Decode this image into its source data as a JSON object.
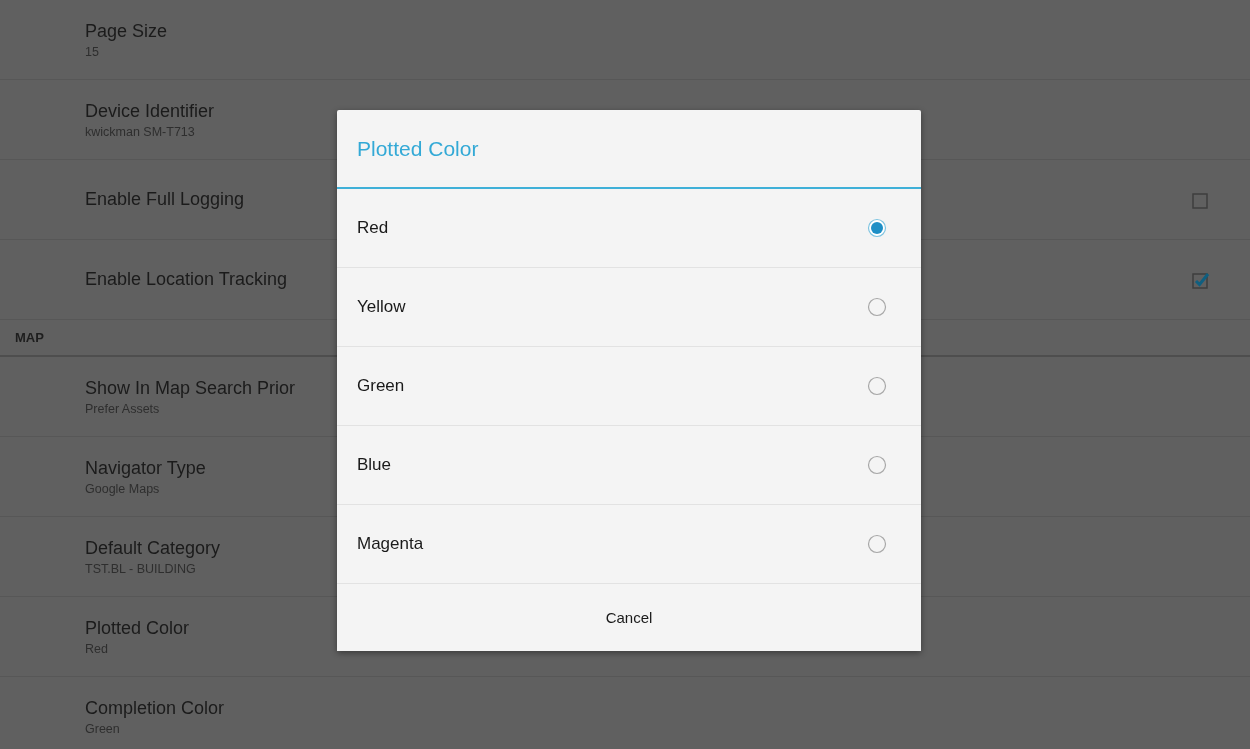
{
  "settings": [
    {
      "kind": "pref",
      "title": "Page Size",
      "summary": "15"
    },
    {
      "kind": "pref",
      "title": "Device Identifier",
      "summary": "kwickman SM-T713"
    },
    {
      "kind": "checkbox",
      "title": "Enable Full Logging",
      "checked": false
    },
    {
      "kind": "checkbox",
      "title": "Enable Location Tracking",
      "checked": true
    },
    {
      "kind": "category",
      "title": "MAP"
    },
    {
      "kind": "pref",
      "title": "Show In Map Search Prior",
      "summary": "Prefer Assets"
    },
    {
      "kind": "pref",
      "title": "Navigator Type",
      "summary": "Google Maps"
    },
    {
      "kind": "pref",
      "title": "Default Category",
      "summary": "TST.BL - BUILDING"
    },
    {
      "kind": "pref",
      "title": "Plotted Color",
      "summary": "Red"
    },
    {
      "kind": "pref",
      "title": "Completion Color",
      "summary": "Green"
    }
  ],
  "dialog": {
    "title": "Plotted Color",
    "options": [
      {
        "label": "Red",
        "selected": true
      },
      {
        "label": "Yellow",
        "selected": false
      },
      {
        "label": "Green",
        "selected": false
      },
      {
        "label": "Blue",
        "selected": false
      },
      {
        "label": "Magenta",
        "selected": false
      }
    ],
    "cancel": "Cancel"
  }
}
